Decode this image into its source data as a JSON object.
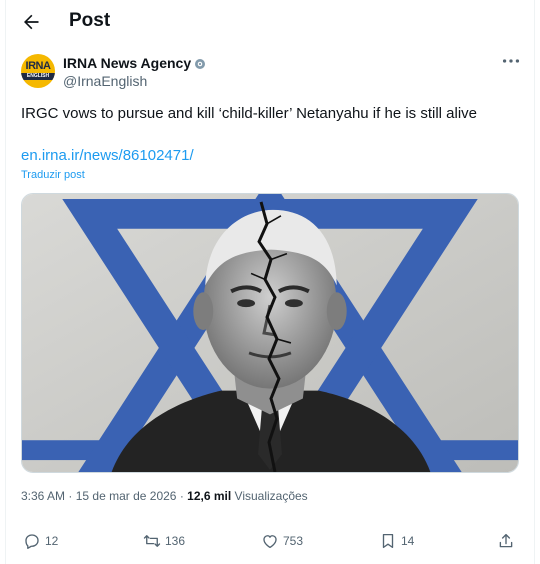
{
  "header": {
    "title": "Post",
    "back_icon": "arrow-left-icon"
  },
  "author": {
    "name": "IRNA News Agency",
    "handle": "@IrnaEnglish",
    "avatar_text": "IRNA",
    "avatar_subtext": "ENGLISH",
    "badge_icon": "government-badge-icon"
  },
  "tweet": {
    "text": "IRGC vows to pursue and kill ‘child-killer’ Netanyahu if he is still alive",
    "link": "en.irna.ir/news/86102471/",
    "translate": "Traduzir post"
  },
  "meta": {
    "time": "3:36 AM",
    "sep1": "·",
    "date": "15 de mar de 2026",
    "sep2": "·",
    "views_count": "12,6 mil",
    "views_label": "Visualizações"
  },
  "actions": {
    "replies": "12",
    "reposts": "136",
    "likes": "753",
    "bookmarks": "14"
  },
  "colors": {
    "accent": "#1d9bf0",
    "secondary_text": "#536471",
    "flag_blue": "#3a62b3"
  }
}
